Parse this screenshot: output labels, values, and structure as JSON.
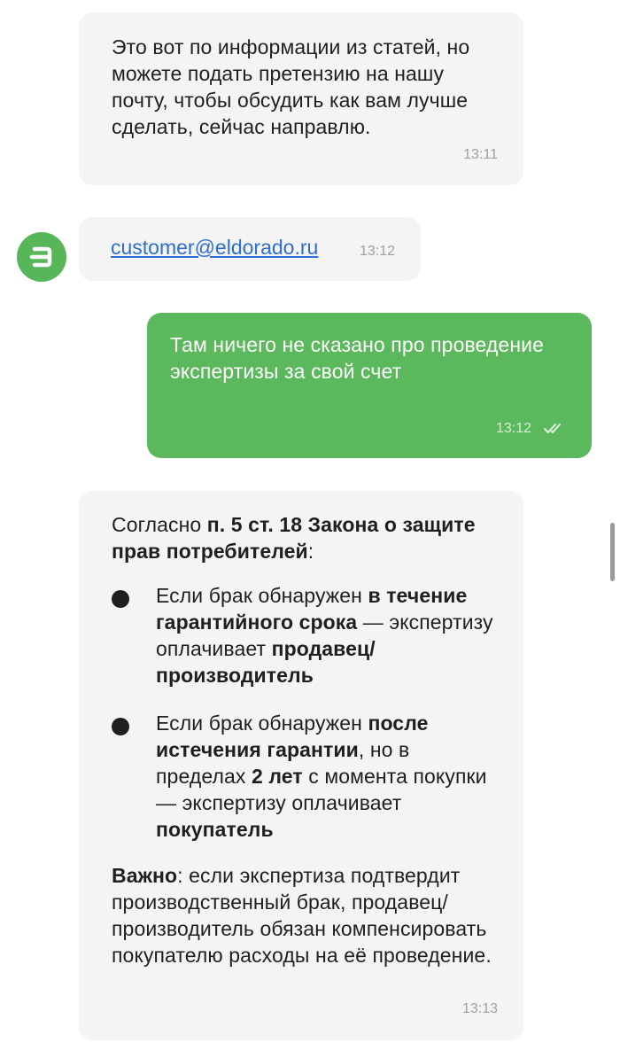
{
  "messages": {
    "m1": {
      "text": "Это вот по информации из статей, но можете подать претензию на нашу почту, чтобы обсудить как вам лучше сделать, сейчас направлю.",
      "time": "13:11"
    },
    "m2": {
      "link": "customer@eldorado.ru",
      "time": "13:12",
      "avatar_icon": "eldorado-logo-icon",
      "avatar_color": "#57b657"
    },
    "m3": {
      "text": "Там ничего не сказано про проведение экспертизы за свой счет",
      "time": "13:12",
      "status_icon": "double-check-icon",
      "bubble_color": "#5cb85c"
    },
    "m4": {
      "intro_prefix": "Согласно ",
      "intro_bold": "п. 5 ст. 18 Закона о защите прав потребителей",
      "intro_suffix": ":",
      "bullets": [
        {
          "p1": "Если брак обнаружен ",
          "b1": "в течение гарантийного срока",
          "p2": " — экспертизу оплачивает ",
          "b2": "продавец/производитель"
        },
        {
          "p1": "Если брак обнаружен ",
          "b1": "после истечения гарантии",
          "p2": ", но в пределах ",
          "b2": "2 лет",
          "p3": " с момента покупки — экспертизу оплачивает ",
          "b3": "покупатель"
        }
      ],
      "note_bold": "Важно",
      "note_text": ": если экспертиза подтвердит производственный брак, продавец/производитель обязан компенсировать покупателю расходы на её проведение.",
      "time": "13:13"
    }
  }
}
